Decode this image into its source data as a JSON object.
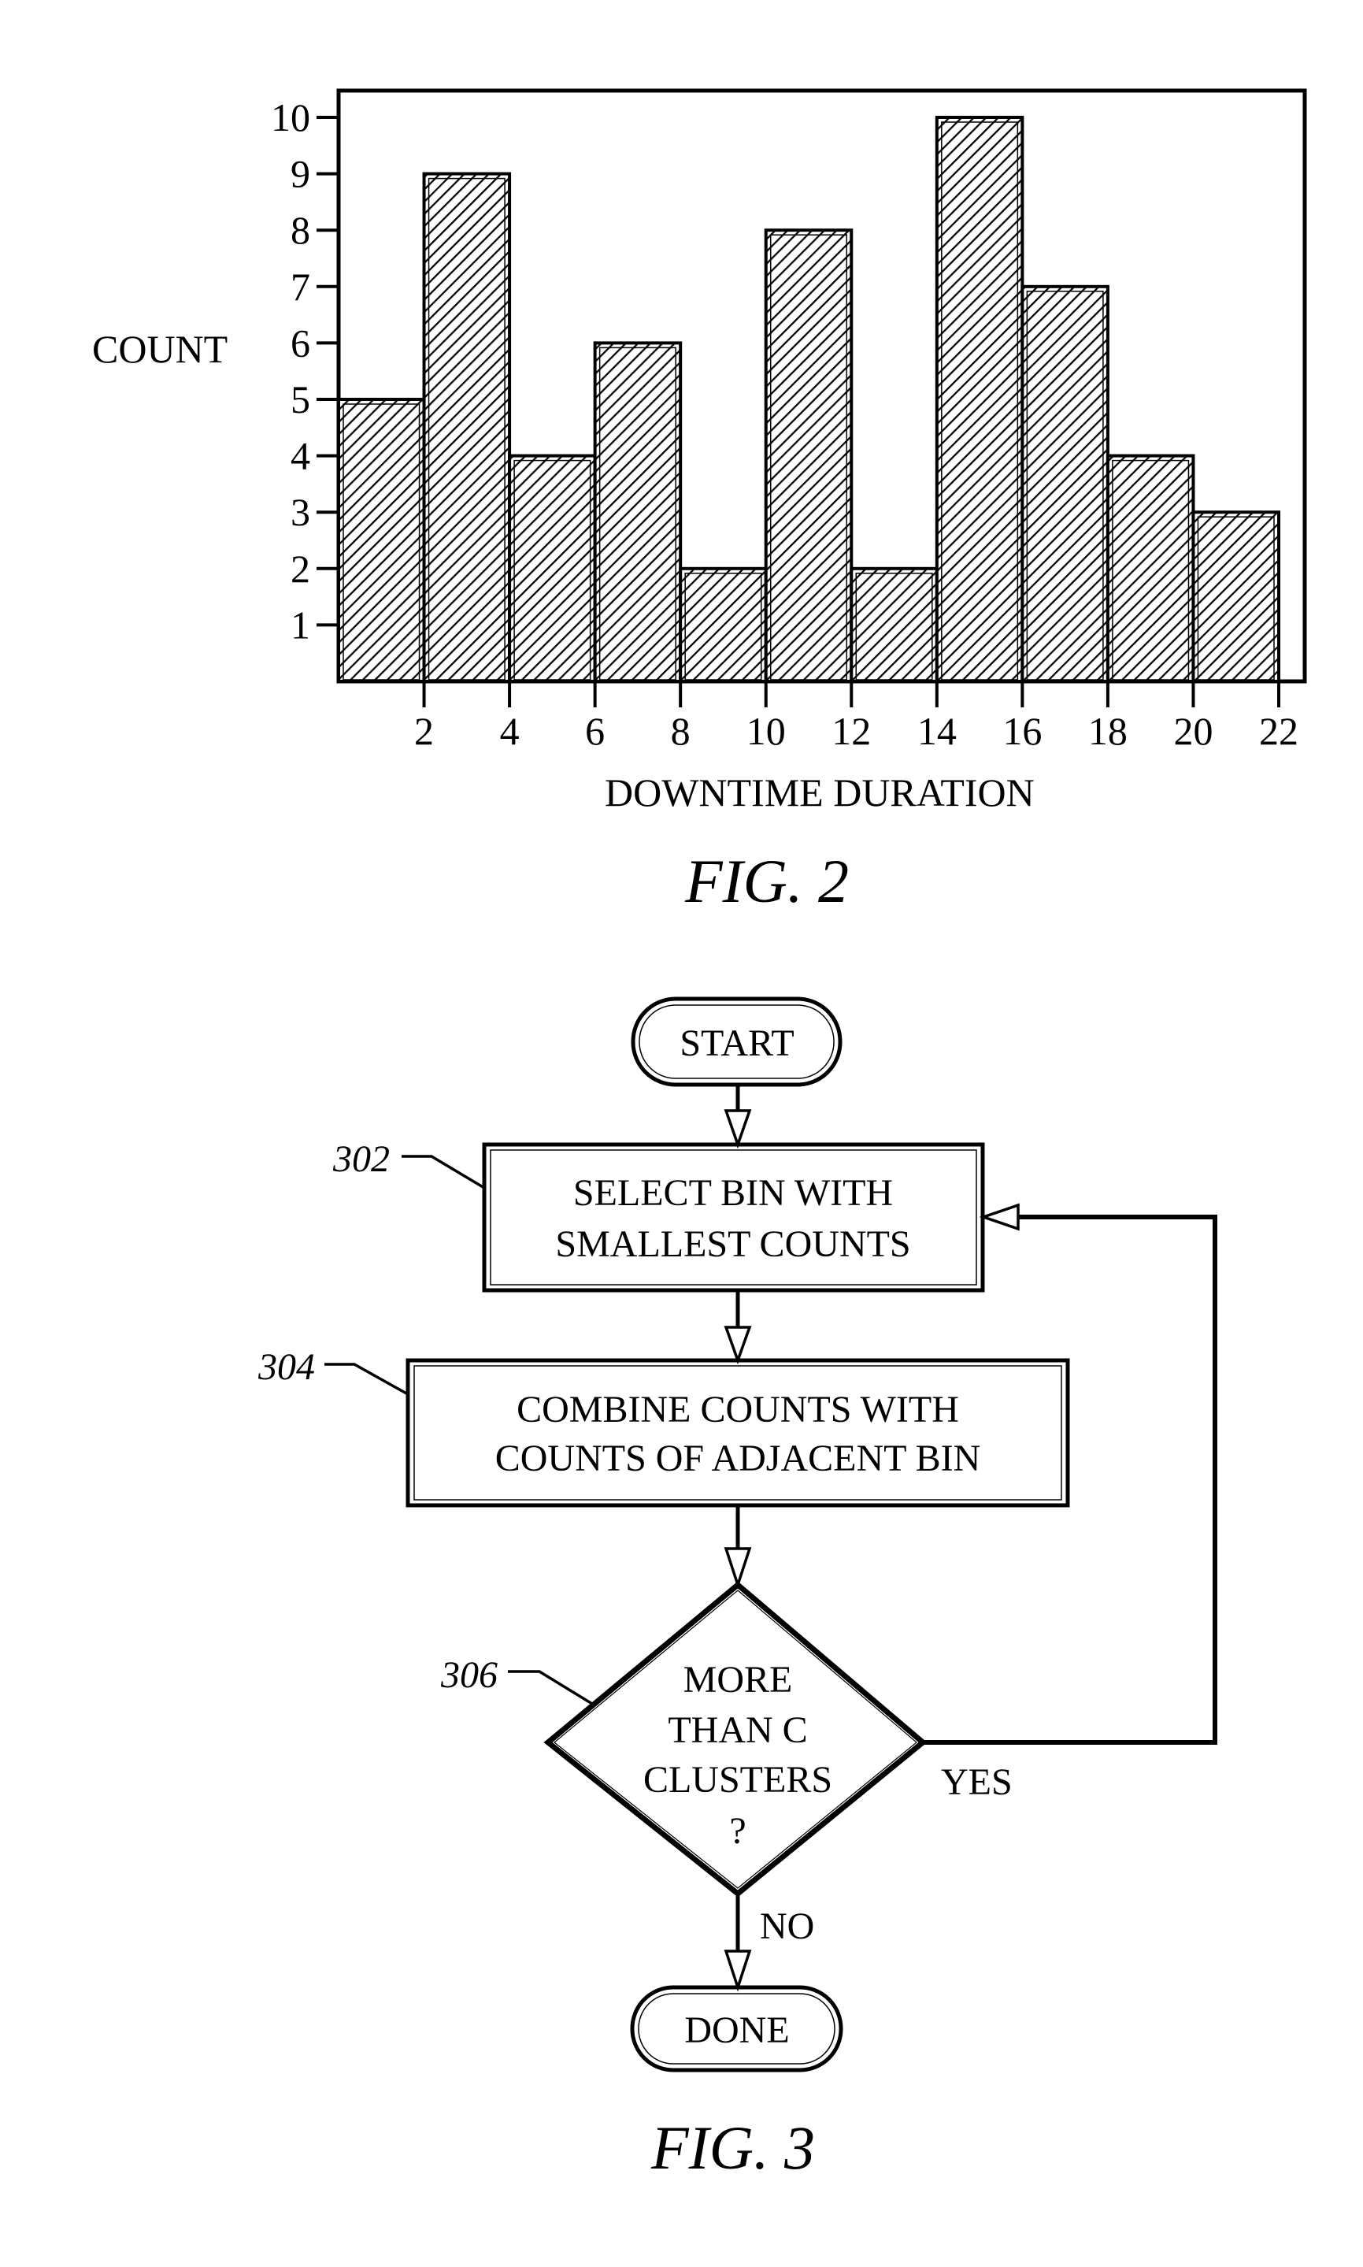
{
  "colors": {
    "ink": "#000000",
    "paper": "#ffffff"
  },
  "chart_data": {
    "type": "bar",
    "subtype": "histogram",
    "caption": "FIG. 2",
    "title": "",
    "xlabel": "DOWNTIME DURATION",
    "ylabel": "COUNT",
    "bins": [
      {
        "from": 0,
        "to": 2,
        "count": 5
      },
      {
        "from": 2,
        "to": 4,
        "count": 9
      },
      {
        "from": 4,
        "to": 6,
        "count": 4
      },
      {
        "from": 6,
        "to": 8,
        "count": 6
      },
      {
        "from": 8,
        "to": 10,
        "count": 2
      },
      {
        "from": 10,
        "to": 12,
        "count": 8
      },
      {
        "from": 12,
        "to": 14,
        "count": 2
      },
      {
        "from": 14,
        "to": 16,
        "count": 10
      },
      {
        "from": 16,
        "to": 18,
        "count": 7
      },
      {
        "from": 18,
        "to": 20,
        "count": 4
      },
      {
        "from": 20,
        "to": 22,
        "count": 3
      }
    ],
    "categories": [
      "0-2",
      "2-4",
      "4-6",
      "6-8",
      "8-10",
      "10-12",
      "12-14",
      "14-16",
      "16-18",
      "18-20",
      "20-22"
    ],
    "values": [
      5,
      9,
      4,
      6,
      2,
      8,
      2,
      10,
      7,
      4,
      3
    ],
    "x_ticks": [
      "2",
      "4",
      "6",
      "8",
      "10",
      "12",
      "14",
      "16",
      "18",
      "20",
      "22"
    ],
    "x_tick_values": [
      2,
      4,
      6,
      8,
      10,
      12,
      14,
      16,
      18,
      20,
      22
    ],
    "y_ticks": [
      "1",
      "2",
      "3",
      "4",
      "5",
      "6",
      "7",
      "8",
      "9",
      "10"
    ],
    "y_tick_values": [
      1,
      2,
      3,
      4,
      5,
      6,
      7,
      8,
      9,
      10
    ],
    "xlim": [
      0,
      22
    ],
    "ylim": [
      0,
      10
    ],
    "fill": "diagonal hatch",
    "grid": false,
    "legend": "none"
  },
  "flowchart": {
    "caption": "FIG. 3",
    "start": {
      "label": "START"
    },
    "steps": [
      {
        "ref": "302",
        "lines": [
          "SELECT BIN WITH",
          "SMALLEST COUNTS"
        ]
      },
      {
        "ref": "304",
        "lines": [
          "COMBINE COUNTS WITH",
          "COUNTS OF ADJACENT BIN"
        ]
      }
    ],
    "decision": {
      "ref": "306",
      "lines": [
        "MORE",
        "THAN C",
        "CLUSTERS",
        "?"
      ]
    },
    "yes_label": "YES",
    "no_label": "NO",
    "end": {
      "label": "DONE"
    }
  }
}
